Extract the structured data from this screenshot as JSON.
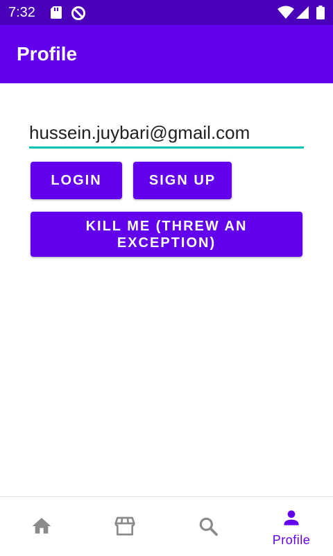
{
  "status_bar": {
    "time": "7:32",
    "left_icons": [
      "sd-card-icon",
      "blocked-icon"
    ],
    "right_icons": [
      "wifi-icon",
      "cell-signal-icon",
      "battery-icon"
    ]
  },
  "app_bar": {
    "title": "Profile"
  },
  "form": {
    "email_value": "hussein.juybari@gmail.com",
    "login_label": "LOGIN",
    "signup_label": "SIGN UP",
    "kill_label": "KILL ME (THREW AN EXCEPTION)"
  },
  "bottom_nav": {
    "items": [
      {
        "icon": "home-icon",
        "label": ""
      },
      {
        "icon": "store-icon",
        "label": ""
      },
      {
        "icon": "search-icon",
        "label": ""
      },
      {
        "icon": "person-icon",
        "label": "Profile"
      }
    ],
    "active_index": 3
  },
  "colors": {
    "primary": "#6200ee",
    "status_bar": "#4a00b8",
    "accent": "#03c4b4",
    "nav_inactive": "#8a8a8a"
  }
}
